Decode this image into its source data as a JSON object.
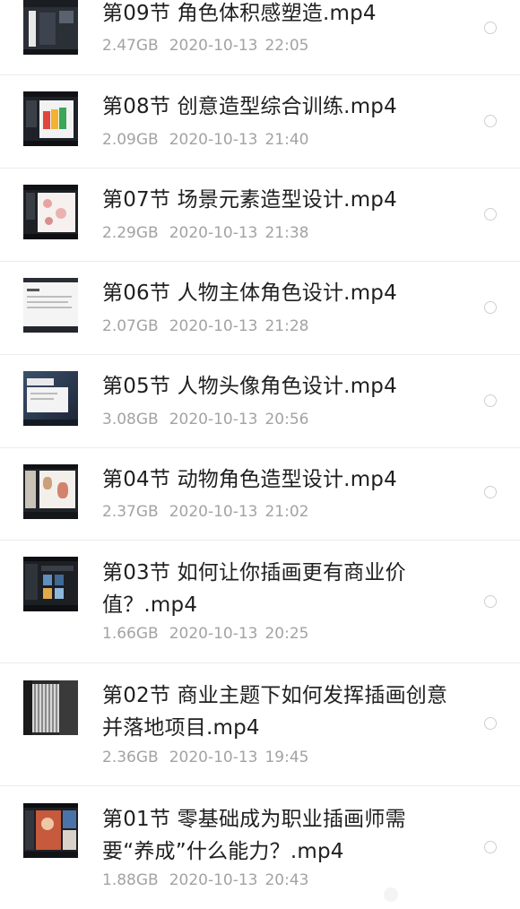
{
  "items": [
    {
      "title": "第09节 角色体积感塑造.mp4",
      "size": "2.47GB",
      "date": "2020-10-13",
      "time": "22:05"
    },
    {
      "title": "第08节 创意造型综合训练.mp4",
      "size": "2.09GB",
      "date": "2020-10-13",
      "time": "21:40"
    },
    {
      "title": "第07节 场景元素造型设计.mp4",
      "size": "2.29GB",
      "date": "2020-10-13",
      "time": "21:38"
    },
    {
      "title": "第06节 人物主体角色设计.mp4",
      "size": "2.07GB",
      "date": "2020-10-13",
      "time": "21:28"
    },
    {
      "title": "第05节 人物头像角色设计.mp4",
      "size": "3.08GB",
      "date": "2020-10-13",
      "time": "20:56"
    },
    {
      "title": "第04节 动物角色造型设计.mp4",
      "size": "2.37GB",
      "date": "2020-10-13",
      "time": "21:02"
    },
    {
      "title": "第03节 如何让你插画更有商业价值？.mp4",
      "size": "1.66GB",
      "date": "2020-10-13",
      "time": "20:25"
    },
    {
      "title": "第02节 商业主题下如何发挥插画创意并落地项目.mp4",
      "size": "2.36GB",
      "date": "2020-10-13",
      "time": "19:45"
    },
    {
      "title": "第01节 零基础成为职业插画师需要“养成”什么能力？.mp4",
      "size": "1.88GB",
      "date": "2020-10-13",
      "time": "20:43"
    }
  ]
}
